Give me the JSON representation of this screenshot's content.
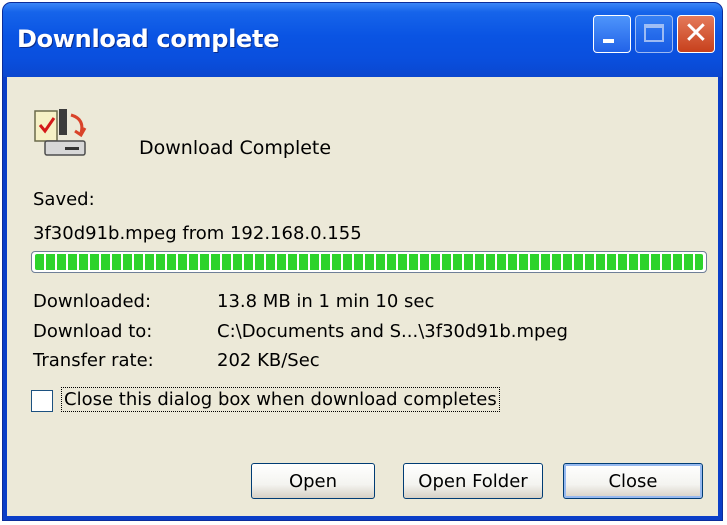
{
  "window": {
    "title": "Download complete"
  },
  "dialog": {
    "heading": "Download Complete",
    "saved_label": "Saved:",
    "saved_file": "3f30d91b.mpeg from 192.168.0.155",
    "progress_fraction": 1.0,
    "rows": [
      {
        "label": "Downloaded:",
        "value": "13.8 MB in 1 min 10 sec"
      },
      {
        "label": "Download to:",
        "value": "C:\\Documents and S...\\3f30d91b.mpeg"
      },
      {
        "label": "Transfer rate:",
        "value": "202 KB/Sec"
      }
    ],
    "close_checkbox_label": "Close this dialog box when download completes",
    "close_checkbox_checked": false
  },
  "buttons": {
    "open": "Open",
    "open_folder": "Open Folder",
    "close": "Close"
  },
  "icons": {
    "download": "download-complete-icon",
    "minimize": "minimize-icon",
    "maximize": "maximize-icon",
    "close": "close-icon"
  },
  "colors": {
    "titlebar": "#0a54e3",
    "progress": "#2dd32b",
    "client_bg": "#ece9d8"
  }
}
